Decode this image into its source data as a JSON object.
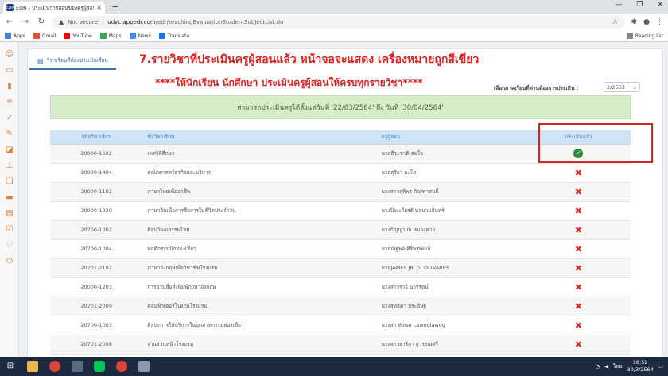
{
  "browser": {
    "tab_title": "EDR - ประเมินการสอนของครูผู้สอนนักศึกษา",
    "not_secure": "Not secure",
    "url_host": "udvc.appedr.com",
    "url_path": "/edr/teachingEvaluationStudentSubjectList.do",
    "bookmarks": [
      "Apps",
      "Gmail",
      "YouTube",
      "Maps",
      "News",
      "Translate"
    ],
    "reading_list": "Reading list"
  },
  "page": {
    "subtab_label": "วิชาเรียนที่ต้องประเมินเรียน",
    "heading1": "7.รายวิชาที่ประเมินครูผู้สอนแล้ว หน้าจอจะแสดง เครื่องหมายถูกสีเขียว",
    "heading2": "****ให้นักเรียน นักศึกษา ประเมินครูผู้สอนให้ครบทุกรายวิชา****",
    "term_label": "เลือกภาคเรียนที่ท่านต้องการประเมิน :",
    "term_value": "2/2563",
    "notice": "สามารถประเมินครูได้ตั้งแต่วันที่ '22/03/2564' ถึง วันที่ '30/04/2564'"
  },
  "table": {
    "headers": {
      "code": "รหัสวิชาเรียน",
      "name": "ชื่อวิชาเรียน",
      "teacher": "ครูผู้สอน",
      "status": "ประเมินแล้ว"
    },
    "rows": [
      {
        "code": "20000-1602",
        "name": "เพศวิถีศึกษา",
        "teacher": "นายธีระชาติ สมใจ",
        "evaluated": true
      },
      {
        "code": "20000-1404",
        "name": "คณิตศาสตร์ธุรกิจและบริการ",
        "teacher": "นายสุริยา ยะโส",
        "evaluated": false
      },
      {
        "code": "20000-1102",
        "name": "ภาษาไทยเพื่ออาชีพ",
        "teacher": "นางสาวสุทิพร กัณฑาสมธิ์",
        "evaluated": false
      },
      {
        "code": "20000-1220",
        "name": "ภาษาจีนเพื่อการสื่อสารในชีวิตประจำวัน",
        "teacher": "นางปิยะเกียรติ พลนามอินทร์",
        "evaluated": false
      },
      {
        "code": "20700-1002",
        "name": "ศิลปวัฒนธรรมไทย",
        "teacher": "นางกัญญา ณ หนองคาย",
        "evaluated": false
      },
      {
        "code": "20700-1004",
        "name": "พฤติกรรมนักท่องเที่ยว",
        "teacher": "นายณัฐพล ศิริพรพัฒน์",
        "evaluated": false
      },
      {
        "code": "20701-2102",
        "name": "ภาษาอังกฤษเพื่อวิชาชีพโรงแรม",
        "teacher": "นายJAMES JR. G. OLIVARES",
        "evaluated": false
      },
      {
        "code": "20000-1203",
        "name": "การอ่านสื่อสิ่งพิมพ์ภาษาอังกฤษ",
        "teacher": "นางสาวราวี นาริรัตน์",
        "evaluated": false
      },
      {
        "code": "20701-2009",
        "name": "คอมพิวเตอร์ในงานโรงแรม",
        "teacher": "นางสุทธิดา ประดิษฐ์",
        "evaluated": false
      },
      {
        "code": "20700-1003",
        "name": "ศิลปะการให้บริการในอุตสาหกรรมท่องเที่ยว",
        "teacher": "นางสาวRose Lawoglawog",
        "evaluated": false
      },
      {
        "code": "20701-2008",
        "name": "งานส่วนหน้าโรงแรม",
        "teacher": "นางสาวธาริกา สุวรรณศรี",
        "evaluated": false
      }
    ]
  },
  "taskbar": {
    "time": "18:52",
    "date": "30/3/2564",
    "lang": "ไทย"
  },
  "colors": {
    "heading_red": "#e01f1f",
    "check_green": "#2e8b3d",
    "x_red": "#d82b2b",
    "notice_bg": "#d7ecc8",
    "header_bg": "#cfe3f5"
  }
}
